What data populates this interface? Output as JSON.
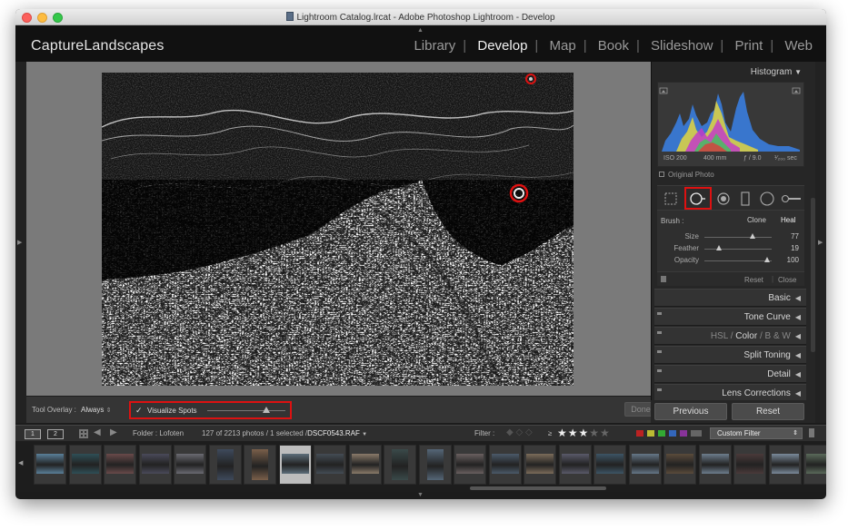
{
  "window": {
    "title": "Lightroom Catalog.lrcat - Adobe Photoshop Lightroom - Develop"
  },
  "header": {
    "brand": "CaptureLandscapes",
    "modules": [
      {
        "label": "Library",
        "active": false
      },
      {
        "label": "Develop",
        "active": true
      },
      {
        "label": "Map",
        "active": false
      },
      {
        "label": "Book",
        "active": false
      },
      {
        "label": "Slideshow",
        "active": false
      },
      {
        "label": "Print",
        "active": false
      },
      {
        "label": "Web",
        "active": false
      }
    ]
  },
  "toolbar": {
    "tool_overlay_label": "Tool Overlay :",
    "tool_overlay_value": "Always",
    "visualize_spots_label": "Visualize Spots",
    "visualize_spots_checked": true,
    "visualize_spots_level": 0.75,
    "done_label": "Done"
  },
  "histogram": {
    "title": "Histogram",
    "iso": "ISO 200",
    "focal": "400 mm",
    "aperture": "ƒ / 9.0",
    "shutter": "¹⁄₂₀₀ sec",
    "original_photo": "Original Photo"
  },
  "spot_removal": {
    "brush_label": "Brush :",
    "clone_label": "Clone",
    "heal_label": "Heal",
    "sliders": [
      {
        "name": "Size",
        "value": "77",
        "pos": 0.72
      },
      {
        "name": "Feather",
        "value": "19",
        "pos": 0.22
      },
      {
        "name": "Opacity",
        "value": "100",
        "pos": 0.93
      }
    ],
    "reset_label": "Reset",
    "close_label": "Close"
  },
  "panels": [
    {
      "label": "Basic"
    },
    {
      "label": "Tone Curve"
    },
    {
      "label": "HSL / Color / B & W"
    },
    {
      "label": "Split Toning"
    },
    {
      "label": "Detail"
    },
    {
      "label": "Lens Corrections"
    }
  ],
  "hsl": {
    "hsl": "HSL",
    "sep": "/",
    "color": "Color",
    "bw": "B & W"
  },
  "buttons": {
    "previous": "Previous",
    "reset": "Reset"
  },
  "filmstrip_bar": {
    "monitor1": "1",
    "monitor2": "2",
    "folder": "Folder : Lofoten",
    "count": "127 of 2213 photos / 1 selected /",
    "filename": "DSCF0543.RAF",
    "filter_label": "Filter :",
    "rating_op": "≥",
    "stars_on": "★★★",
    "stars_off": "★★",
    "custom_filter": "Custom Filter"
  },
  "colors": {
    "selection_red": "#dd1111",
    "histogram_blue": "#3a7dde",
    "histogram_yellow": "#e2d640",
    "histogram_magenta": "#c23cc8"
  }
}
